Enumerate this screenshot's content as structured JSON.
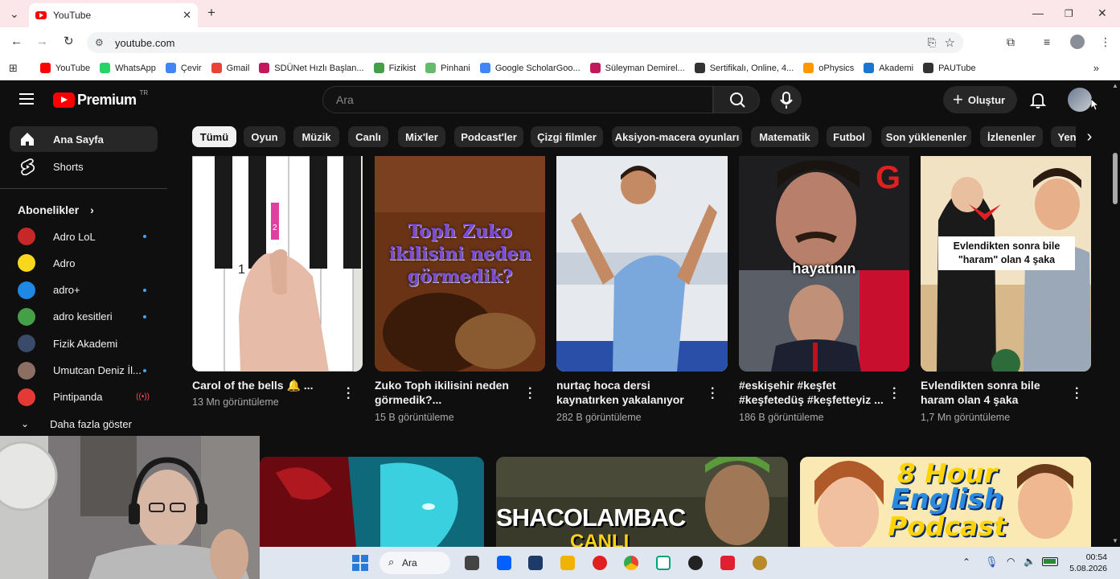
{
  "browser": {
    "tab_title": "YouTube",
    "url": "youtube.com",
    "bookmarks": [
      {
        "label": "YouTube",
        "color": "#ff0000"
      },
      {
        "label": "WhatsApp",
        "color": "#25d366"
      },
      {
        "label": "Çevir",
        "color": "#4285f4"
      },
      {
        "label": "Gmail",
        "color": "#ea4335"
      },
      {
        "label": "SDÜNet Hızlı Başlan...",
        "color": "#c2185b"
      },
      {
        "label": "Fizikist",
        "color": "#43a047"
      },
      {
        "label": "Pinhani",
        "color": "#66bb6a"
      },
      {
        "label": "Google ScholarGoo...",
        "color": "#4285f4"
      },
      {
        "label": "Süleyman Demirel...",
        "color": "#c2185b"
      },
      {
        "label": "Sertifikalı, Online, 4...",
        "color": "#333333"
      },
      {
        "label": "oPhysics",
        "color": "#ff9800"
      },
      {
        "label": "Akademi",
        "color": "#1976d2"
      },
      {
        "label": "PAUTube",
        "color": "#333333"
      }
    ]
  },
  "youtube": {
    "logo_text": "Premium",
    "logo_country": "TR",
    "search_placeholder": "Ara",
    "create_label": "Oluştur",
    "sidebar": {
      "main": [
        {
          "label": "Ana Sayfa",
          "icon": "home-icon",
          "active": true
        },
        {
          "label": "Shorts",
          "icon": "shorts-icon",
          "active": false
        }
      ],
      "subs_heading": "Abonelikler",
      "subscriptions": [
        {
          "label": "Adro LoL",
          "color": "#c62828",
          "dot": true
        },
        {
          "label": "Adro",
          "color": "#f9d71c",
          "dot": false
        },
        {
          "label": "adro+",
          "color": "#1e88e5",
          "dot": true
        },
        {
          "label": "adro kesitleri",
          "color": "#43a047",
          "dot": true
        },
        {
          "label": "Fizik Akademi",
          "color": "#3a4a6a",
          "dot": false
        },
        {
          "label": "Umutcan Deniz İl...",
          "color": "#8d6e63",
          "dot": true
        },
        {
          "label": "Pintipanda",
          "color": "#e53935",
          "live": true
        }
      ],
      "show_more": "Daha fazla göster"
    },
    "chips": [
      "Tümü",
      "Oyun",
      "Müzik",
      "Canlı",
      "Mix'ler",
      "Podcast'ler",
      "Çizgi filmler",
      "Aksiyon-macera oyunları",
      "Matematik",
      "Futbol",
      "Son yüklenenler",
      "İzlenenler",
      "Yen"
    ],
    "videos": [
      {
        "title": "Carol of the bells 🔔 ...",
        "meta": "13 Mn görüntüleme"
      },
      {
        "title": "Zuko Toph ikilisini neden görmedik?...",
        "meta": "15 B görüntüleme",
        "thumb_text": "Toph Zuko ikilisini neden görmedik?"
      },
      {
        "title": "nurtaç hoca dersi kaynatırken yakalanıyor",
        "meta": "282 B görüntüleme"
      },
      {
        "title": "#eskişehir #keşfet #keşfetedüş #keşfetteyiz ...",
        "meta": "186 B görüntüleme",
        "thumb_text": "hayatının"
      },
      {
        "title": "Evlendikten sonra bile haram olan 4 şaka",
        "meta": "1,7 Mn görüntüleme",
        "thumb_text": "Evlendikten sonra bile \"haram\" olan 4 şaka"
      }
    ],
    "row2": [
      {
        "thumb_text": ""
      },
      {
        "thumb_text": "SHACOLAMBAC",
        "thumb_sub": "CANLI"
      },
      {
        "thumb_text": "8 Hour",
        "thumb_text2": "English",
        "thumb_text3": "Podcast"
      }
    ]
  },
  "taskbar": {
    "search_label": "Ara",
    "time": "00:54",
    "date": "5.08.2026"
  }
}
